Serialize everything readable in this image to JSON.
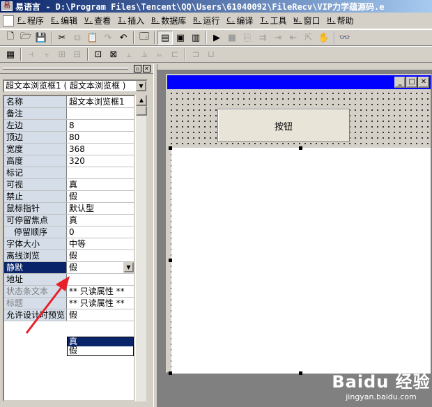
{
  "window": {
    "title": "易语言 - D:\\Program Files\\Tencent\\QQ\\Users\\61040092\\FileRecv\\VIP力学蕴源码.e"
  },
  "menu": [
    {
      "key": "F.",
      "label": "程序"
    },
    {
      "key": "E.",
      "label": "编辑"
    },
    {
      "key": "V.",
      "label": "查看"
    },
    {
      "key": "I.",
      "label": "插入"
    },
    {
      "key": "B.",
      "label": "数据库"
    },
    {
      "key": "R.",
      "label": "运行"
    },
    {
      "key": "C.",
      "label": "编译"
    },
    {
      "key": "T.",
      "label": "工具"
    },
    {
      "key": "W.",
      "label": "窗口"
    },
    {
      "key": "H.",
      "label": "帮助"
    }
  ],
  "toolbar1": {
    "icons": [
      "new-icon",
      "open-icon",
      "save-icon",
      "cut-icon",
      "copy-icon",
      "paste-icon",
      "redo-icon",
      "undo-icon",
      "find-icon",
      "layout1-icon",
      "layout2-icon",
      "layout3-icon",
      "run-icon",
      "stop-icon",
      "step1-icon",
      "step2-icon",
      "step3-icon",
      "step4-icon",
      "step5-icon",
      "hand-icon",
      "binoculars-icon"
    ],
    "glyphs": [
      "🗋",
      "🗁",
      "💾",
      "✂",
      "⧉",
      "📋",
      "↷",
      "↶",
      "🗔",
      "▤",
      "▣",
      "▥",
      "▶",
      "■",
      "⎘",
      "⇉",
      "⇥",
      "⇤",
      "⇱",
      "✋",
      "👓"
    ]
  },
  "toolbar2": {
    "glyphs": [
      "▦",
      "⫞",
      "⫟",
      "⊞",
      "⊟",
      "⊡",
      "⊠",
      "⫠",
      "⫡",
      "⫢",
      "⊏",
      "⊐",
      "⊔"
    ]
  },
  "property_panel": {
    "selector_value": "超文本浏览框1 ( 超文本浏览框 )",
    "rows": [
      {
        "name": "名称",
        "value": "超文本浏览框1"
      },
      {
        "name": "备注",
        "value": ""
      },
      {
        "name": "左边",
        "value": "8"
      },
      {
        "name": "顶边",
        "value": "80"
      },
      {
        "name": "宽度",
        "value": "368"
      },
      {
        "name": "高度",
        "value": "320"
      },
      {
        "name": "标记",
        "value": ""
      },
      {
        "name": "可视",
        "value": "真"
      },
      {
        "name": "禁止",
        "value": "假"
      },
      {
        "name": "鼠标指针",
        "value": "默认型"
      },
      {
        "name": "可停留焦点",
        "value": "真"
      },
      {
        "name": "停留顺序",
        "value": "0"
      },
      {
        "name": "字体大小",
        "value": "中等"
      },
      {
        "name": "离线浏览",
        "value": "假"
      },
      {
        "name": "静默",
        "value": "假"
      },
      {
        "name": "地址",
        "value": ""
      },
      {
        "name": "状态条文本",
        "value": "** 只读属性 **"
      },
      {
        "name": "标题",
        "value": "** 只读属性 **"
      },
      {
        "name": "允许设计时预览",
        "value": "假"
      }
    ],
    "dropdown_options": [
      "真",
      "假"
    ]
  },
  "design": {
    "button_label": "按钮",
    "win_btn_min": "_",
    "win_btn_max": "□",
    "win_btn_close": "✕"
  },
  "watermark": {
    "logo": "Baidu 经验",
    "url": "jingyan.baidu.com"
  }
}
